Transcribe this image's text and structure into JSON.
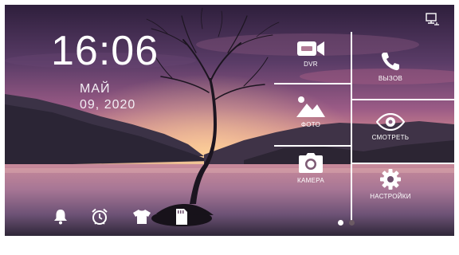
{
  "clock": {
    "time": "16:06",
    "month": "МАЙ",
    "date": "09, 2020"
  },
  "menu": {
    "dvr": {
      "label": "DVR",
      "icon": "video-camera-icon"
    },
    "photo": {
      "label": "ФОТО",
      "icon": "mountain-photo-icon"
    },
    "camera": {
      "label": "КАМЕРА",
      "icon": "camera-icon"
    },
    "call": {
      "label": "ВЫЗОВ",
      "icon": "phone-icon"
    },
    "watch": {
      "label": "СМОТРЕТЬ",
      "icon": "eye-icon"
    },
    "settings": {
      "label": "НАСТРОЙКИ",
      "icon": "gear-icon"
    }
  },
  "bottom_bar": [
    {
      "icon": "bell-icon"
    },
    {
      "icon": "alarm-clock-icon"
    },
    {
      "icon": "tshirt-icon"
    },
    {
      "icon": "sd-card-icon"
    }
  ],
  "status": {
    "icon": "network-icon"
  },
  "pager": {
    "pages": 2,
    "active_page": 1
  },
  "colors": {
    "text": "#ffffff",
    "dot_active": "#ffffff",
    "dot_inactive": "#6b5a63"
  }
}
